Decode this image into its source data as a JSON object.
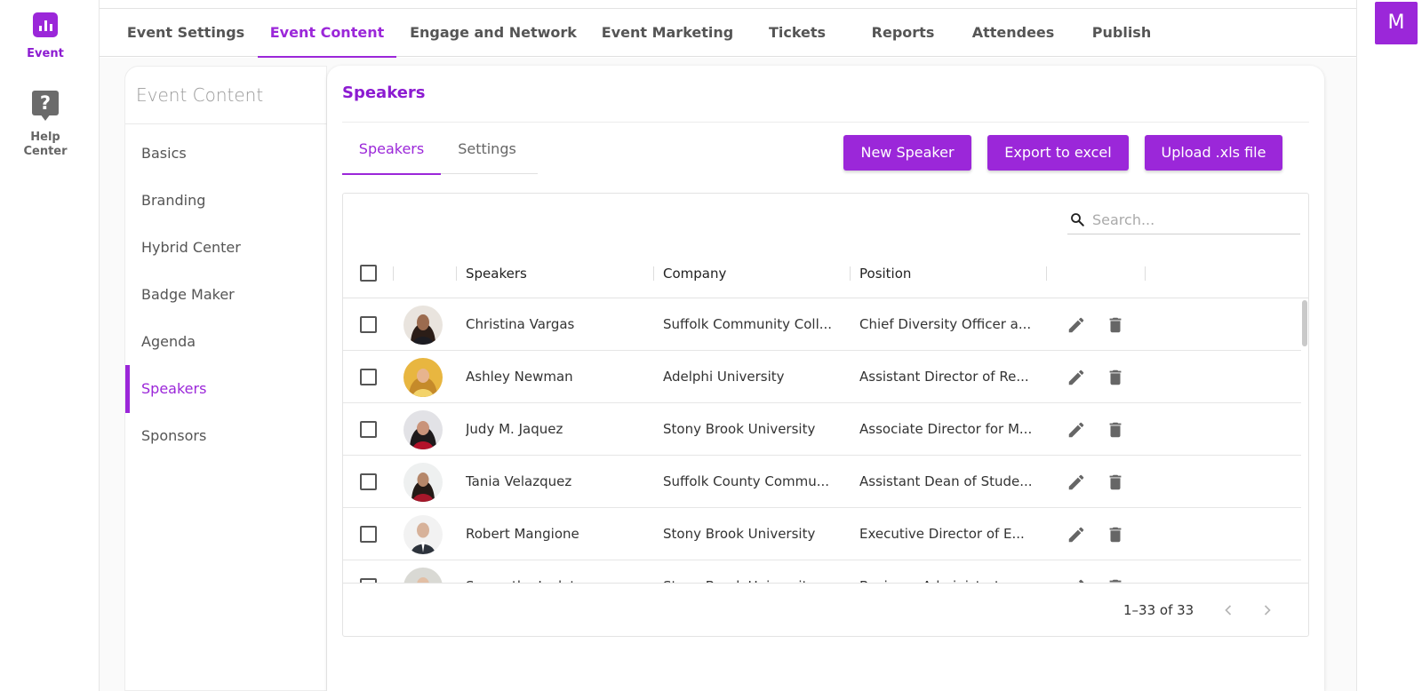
{
  "rail": {
    "event_label": "Event",
    "help_label_line1": "Help",
    "help_label_line2": "Center",
    "help_glyph": "?"
  },
  "user": {
    "initial": "M"
  },
  "topnav": {
    "tabs": [
      {
        "label": "Event Settings"
      },
      {
        "label": "Event Content",
        "active": true
      },
      {
        "label": "Engage and Network"
      },
      {
        "label": "Event Marketing"
      },
      {
        "label": "Tickets"
      },
      {
        "label": "Reports"
      },
      {
        "label": "Attendees"
      },
      {
        "label": "Publish"
      }
    ]
  },
  "subnav": {
    "title": "Event Content",
    "items": [
      {
        "label": "Basics"
      },
      {
        "label": "Branding"
      },
      {
        "label": "Hybrid Center"
      },
      {
        "label": "Badge Maker"
      },
      {
        "label": "Agenda"
      },
      {
        "label": "Speakers",
        "active": true
      },
      {
        "label": "Sponsors"
      }
    ]
  },
  "card": {
    "title": "Speakers",
    "tabs": [
      {
        "label": "Speakers",
        "active": true
      },
      {
        "label": "Settings"
      }
    ],
    "buttons": {
      "new": "New Speaker",
      "export": "Export to excel",
      "upload": "Upload .xls file"
    }
  },
  "table": {
    "search_placeholder": "Search...",
    "columns": [
      "Speakers",
      "Company",
      "Position"
    ],
    "rows": [
      {
        "name": "Christina Vargas",
        "company": "Suffolk Community Coll...",
        "position": "Chief Diversity Officer a..."
      },
      {
        "name": "Ashley Newman",
        "company": "Adelphi University",
        "position": "Assistant Director of Re..."
      },
      {
        "name": "Judy M. Jaquez",
        "company": "Stony Brook University",
        "position": "Associate Director for M..."
      },
      {
        "name": "Tania Velazquez",
        "company": "Suffolk County Commu...",
        "position": "Assistant Dean of Stude..."
      },
      {
        "name": "Robert Mangione",
        "company": "Stony Brook University",
        "position": "Executive Director of E..."
      },
      {
        "name": "Samantha Lodato",
        "company": "Stony Brook University",
        "position": "Business Administrator..."
      }
    ],
    "pagination": "1–33 of 33"
  },
  "colors": {
    "accent": "#9b27d9"
  },
  "icons": {
    "rail_event": "bar-chart-icon",
    "rail_help": "help-bubble-icon",
    "search": "search-icon",
    "edit": "pencil-icon",
    "delete": "trash-icon",
    "prev": "chevron-left-icon",
    "next": "chevron-right-icon"
  }
}
